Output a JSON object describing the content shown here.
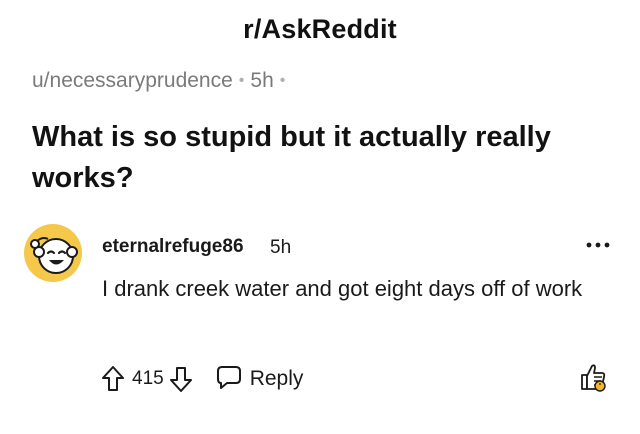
{
  "post": {
    "subreddit": "r/AskReddit",
    "author": "u/necessaryprudence",
    "time": "5h",
    "title": "What is so stupid but it actually really works?"
  },
  "comment": {
    "author": "eternalrefuge86",
    "time": "5h",
    "body": "I drank creek water and got eight days off of work",
    "score": "415",
    "reply_label": "Reply"
  },
  "icons": {
    "avatar": "snoo-avatar-icon",
    "upvote": "upvote-arrow-icon",
    "downvote": "downvote-arrow-icon",
    "reply": "speech-bubble-icon",
    "more": "more-dots-icon",
    "award": "award-thumbs-up-icon"
  },
  "colors": {
    "avatar_bg": "#f5c84c",
    "award_accent": "#f2b531"
  }
}
